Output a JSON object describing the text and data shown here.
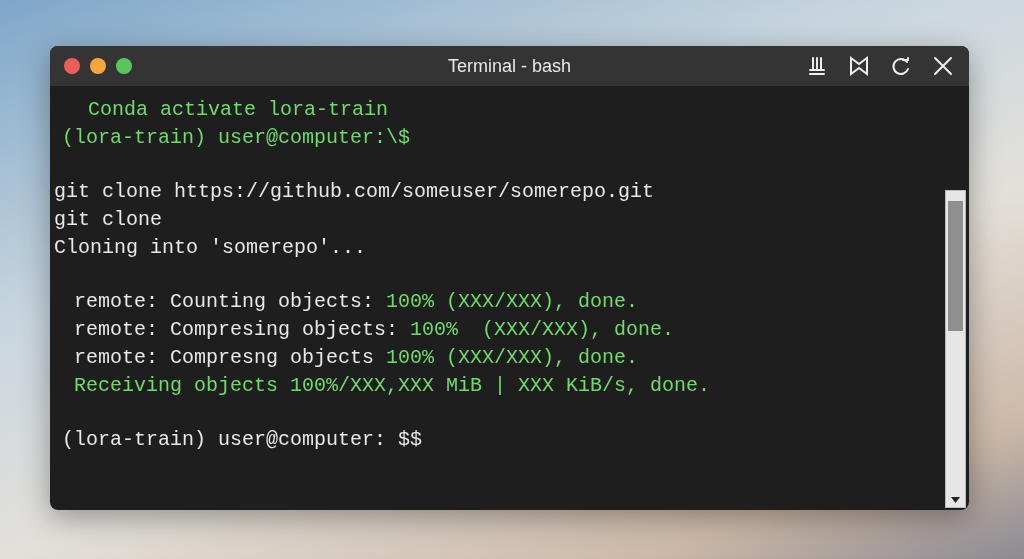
{
  "window": {
    "title": "Terminal - bash",
    "controls": [
      {
        "kind": "pin"
      },
      {
        "kind": "tile"
      },
      {
        "kind": "refresh"
      },
      {
        "kind": "close"
      }
    ]
  },
  "blocks": [
    {
      "lines": [
        {
          "kind": "echo",
          "segments": [
            {
              "text": "Conda activate lora-train",
              "color": "#6fdc6a"
            }
          ]
        },
        {
          "kind": "prompt",
          "segments": [
            {
              "text": "(lora-train) user@computer:\\$",
              "color": "#6fdc6a"
            }
          ]
        }
      ]
    },
    {
      "lines": [
        {
          "kind": "output",
          "segments": [
            {
              "text": "git clone https://github.com/someuser/somerepo.git",
              "color": "#e8e8e8"
            }
          ]
        },
        {
          "kind": "output",
          "segments": [
            {
              "text": "git clone",
              "color": "#e8e8e8"
            }
          ]
        },
        {
          "kind": "output",
          "segments": [
            {
              "text": "Cloning into 'somerepo'...",
              "color": "#e8e8e8"
            }
          ]
        }
      ]
    },
    {
      "lines": [
        {
          "kind": "remote",
          "segments": [
            {
              "text": "remote: Counting objects:",
              "color": "#e8e8e8"
            },
            {
              "text": "100% (XXX/XXX), done.",
              "color": "#6fdc6a"
            }
          ]
        },
        {
          "kind": "remote",
          "segments": [
            {
              "text": "remote: Compresing objects:",
              "color": "#e8e8e8"
            },
            {
              "text": "100%  (XXX/XXX), done.",
              "color": "#6fdc6a"
            }
          ]
        },
        {
          "kind": "remote",
          "segments": [
            {
              "text": "remote: Compresng objects",
              "color": "#e8e8e8"
            },
            {
              "text": "100% (XXX/XXX), done.",
              "color": "#6fdc6a"
            }
          ]
        },
        {
          "kind": "remote",
          "segments": [
            {
              "text": "Receiving objects 100%/XXX,XXX MiB | XXX KiB/s, done.",
              "color": "#6fdc6a"
            }
          ]
        }
      ]
    },
    {
      "lines": [
        {
          "kind": "prompt",
          "segments": [
            {
              "text": "(lora-train) user@computer:",
              "color": "#e8e8e8"
            },
            {
              "text": "$$",
              "color": "#e8e8e8"
            }
          ]
        }
      ]
    }
  ]
}
